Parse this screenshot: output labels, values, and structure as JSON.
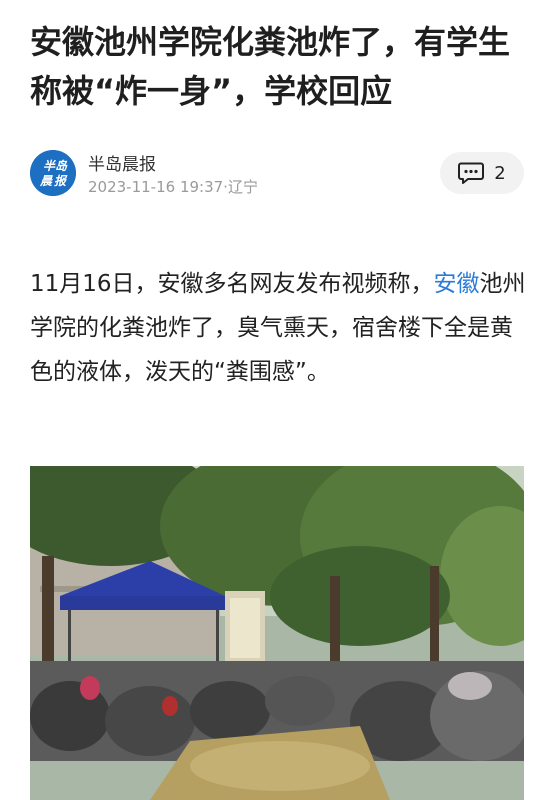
{
  "article": {
    "title": "安徽池州学院化粪池炸了，有学生称被“炸一身”，学校回应",
    "body_before_link": "11月16日，安徽多名网友发布视频称，",
    "body_link": "安徽",
    "body_after_link": "池州学院的化粪池炸了，臭气熏天，宿舍楼下全是黄色的液体，泼天的“粪围感”。"
  },
  "author": {
    "name": "半岛晨报",
    "logo_text": "半岛晨报",
    "datetime": "2023-11-16 19:37",
    "location": "·辽宁",
    "avatar_color": "#1d6fc2"
  },
  "comments": {
    "count": "2",
    "icon": "comment-icon"
  },
  "photo": {
    "icon": "campus-photo"
  }
}
